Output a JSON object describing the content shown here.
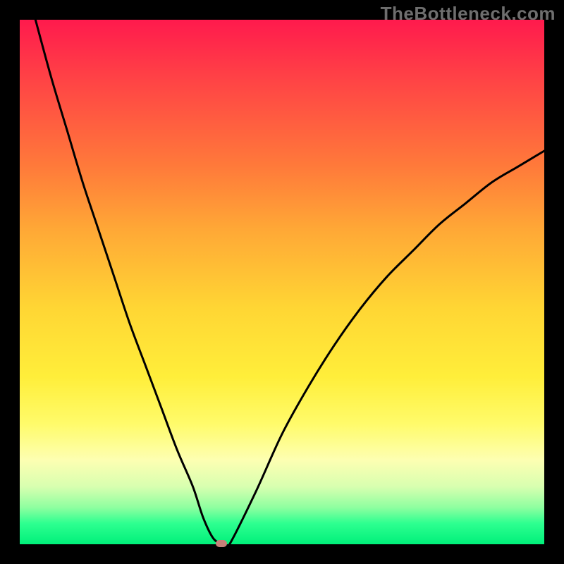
{
  "watermark": "TheBottleneck.com",
  "chart_data": {
    "type": "line",
    "title": "",
    "xlabel": "",
    "ylabel": "",
    "xlim": [
      0,
      100
    ],
    "ylim": [
      0,
      100
    ],
    "grid": false,
    "legend": false,
    "background_gradient": {
      "top": "#ff1a4d",
      "middle": "#ffee3a",
      "bottom": "#00f07a"
    },
    "series": [
      {
        "name": "bottleneck-curve",
        "x": [
          3,
          6,
          9,
          12,
          15,
          18,
          21,
          24,
          27,
          30,
          33,
          35,
          37,
          39,
          40,
          45,
          50,
          55,
          60,
          65,
          70,
          75,
          80,
          85,
          90,
          95,
          100
        ],
        "y": [
          100,
          89,
          79,
          69,
          60,
          51,
          42,
          34,
          26,
          18,
          11,
          5,
          1,
          0,
          0,
          10,
          21,
          30,
          38,
          45,
          51,
          56,
          61,
          65,
          69,
          72,
          75
        ]
      }
    ],
    "minimum_marker": {
      "x": 38.5,
      "y": 0
    }
  }
}
